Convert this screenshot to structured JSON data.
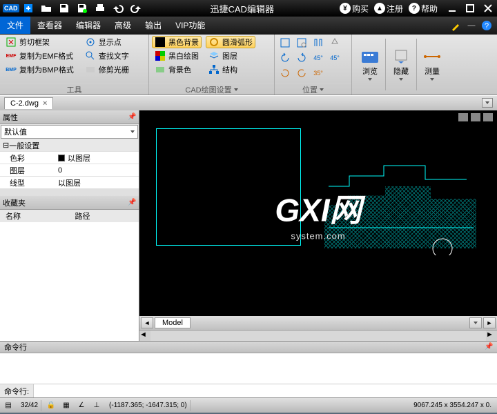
{
  "title": "迅捷CAD编辑器",
  "titlebar": {
    "buy": "购买",
    "register": "注册",
    "help": "帮助"
  },
  "menu": {
    "file": "文件",
    "viewer": "查看器",
    "editor": "编辑器",
    "advanced": "高级",
    "output": "输出",
    "vip": "VIP功能"
  },
  "ribbon": {
    "group1": {
      "label": "工具",
      "clip_frame": "剪切框架",
      "copy_emf": "复制为EMF格式",
      "copy_bmp": "复制为BMP格式",
      "show_point": "显示点",
      "find_text": "查找文字",
      "trim_clip": "修剪光栅"
    },
    "group2": {
      "label": "CAD绘图设置",
      "black_bg": "黑色背景",
      "bw_draw": "黑白绘图",
      "bg_color": "背景色",
      "smooth_arc": "圆滑弧形",
      "layer": "图层",
      "structure": "结构"
    },
    "group3": {
      "label": "位置"
    },
    "browse": "浏览",
    "hide": "隐藏",
    "measure": "测量"
  },
  "filetab": {
    "name": "C-2.dwg"
  },
  "props": {
    "title": "属性",
    "default_combo": "默认值",
    "general": "一般设置",
    "color": "色彩",
    "color_val": "以图层",
    "layer": "图层",
    "layer_val": "0",
    "linetype": "线型",
    "linetype_val": "以图层"
  },
  "fav": {
    "title": "收藏夹",
    "col_name": "名称",
    "col_path": "路径"
  },
  "model": "Model",
  "watermark": {
    "big": "GXI网",
    "small": "system.com"
  },
  "cmd": {
    "title": "命令行",
    "prompt": "命令行:"
  },
  "status": {
    "pages": "32/42",
    "coords": "(-1187.365; -1647.315; 0)",
    "dims": "9067.245 x 3554.247 x 0."
  }
}
